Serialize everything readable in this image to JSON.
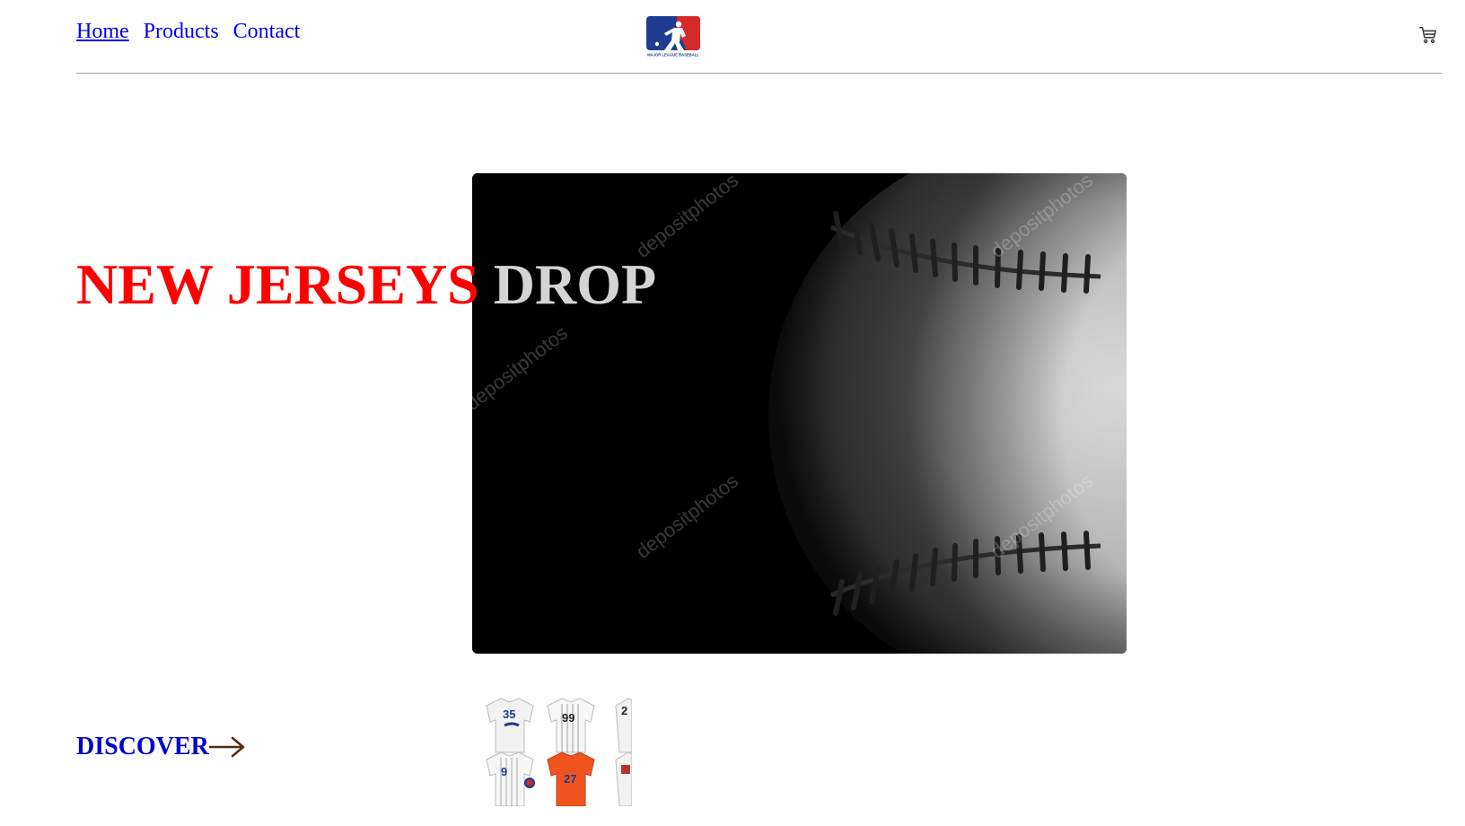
{
  "nav": {
    "items": [
      {
        "label": "Home",
        "active": true
      },
      {
        "label": "Products",
        "active": false
      },
      {
        "label": "Contact",
        "active": false
      }
    ]
  },
  "brand": {
    "logo_text": "MAJOR LEAGUE BASEBALL",
    "logo_colors": {
      "left": "#1d3e8f",
      "right": "#d32b2b"
    }
  },
  "header": {
    "cart_icon": "cart-icon"
  },
  "hero": {
    "headline_part1": "NEW JERSEYS",
    "headline_part2": "DROP",
    "image": "baseball-closeup",
    "watermark": "depositphotos"
  },
  "cta": {
    "label": "DISCOVER",
    "icon": "arrow-right-icon"
  },
  "thumbnail": {
    "image": "jerseys-collage",
    "jersey_numbers": [
      "35",
      "99",
      "2",
      "9",
      "27"
    ]
  },
  "colors": {
    "link": "#0000ee",
    "headline_red": "#ff0000",
    "headline_grey": "#d4d4d4",
    "cta_blue": "#0000cd",
    "arrow": "#5a2a0a"
  }
}
